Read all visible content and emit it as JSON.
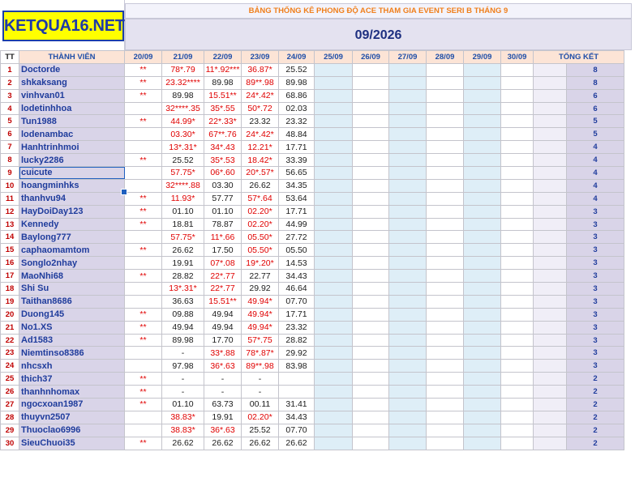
{
  "logo": "KETQUA16.NET",
  "title": "BẢNG THỐNG KÊ PHONG ĐỘ ACE THAM GIA EVENT SERI B THÁNG 9",
  "month": "09/2026",
  "headers": {
    "tt": "TT",
    "member": "THÀNH VIÊN",
    "dates": [
      "20/09",
      "21/09",
      "22/09",
      "23/09",
      "24/09",
      "25/09",
      "26/09",
      "27/09",
      "28/09",
      "29/09",
      "30/09"
    ],
    "total": "TỔNG KẾT"
  },
  "rows": [
    {
      "tt": "1",
      "name": "Doctorde",
      "c": [
        "**",
        "78*.79",
        "11*.92***",
        "36.87*",
        "25.52"
      ],
      "red": [
        true,
        true,
        true,
        true,
        false
      ],
      "total": "8"
    },
    {
      "tt": "2",
      "name": "shkaksang",
      "c": [
        "**",
        "23.32****",
        "89.98",
        "89**.98",
        "89.98"
      ],
      "red": [
        true,
        true,
        false,
        true,
        false
      ],
      "total": "8"
    },
    {
      "tt": "3",
      "name": "vinhvan01",
      "c": [
        "**",
        "89.98",
        "15.51**",
        "24*.42*",
        "68.86"
      ],
      "red": [
        true,
        false,
        true,
        true,
        false
      ],
      "total": "6"
    },
    {
      "tt": "4",
      "name": "lodetinhhoa",
      "c": [
        "",
        "32****.35",
        "35*.55",
        "50*.72",
        "02.03"
      ],
      "red": [
        false,
        true,
        true,
        true,
        false
      ],
      "total": "6"
    },
    {
      "tt": "5",
      "name": "Tun1988",
      "c": [
        "**",
        "44.99*",
        "22*.33*",
        "23.32",
        "23.32"
      ],
      "red": [
        true,
        true,
        true,
        false,
        false
      ],
      "total": "5"
    },
    {
      "tt": "6",
      "name": "lodenambac",
      "c": [
        "",
        "03.30*",
        "67**.76",
        "24*.42*",
        "48.84"
      ],
      "red": [
        false,
        true,
        true,
        true,
        false
      ],
      "total": "5"
    },
    {
      "tt": "7",
      "name": "Hanhtrinhmoi",
      "c": [
        "",
        "13*.31*",
        "34*.43",
        "12.21*",
        "17.71"
      ],
      "red": [
        false,
        true,
        true,
        true,
        false
      ],
      "total": "4"
    },
    {
      "tt": "8",
      "name": "lucky2286",
      "c": [
        "**",
        "25.52",
        "35*.53",
        "18.42*",
        "33.39"
      ],
      "red": [
        true,
        false,
        true,
        true,
        false
      ],
      "total": "4"
    },
    {
      "tt": "9",
      "name": "cuicute",
      "c": [
        "",
        "57.75*",
        "06*.60",
        "20*.57*",
        "56.65"
      ],
      "red": [
        false,
        true,
        true,
        true,
        false
      ],
      "total": "4"
    },
    {
      "tt": "10",
      "name": "hoangminhks",
      "c": [
        "",
        "32****.88",
        "03.30",
        "26.62",
        "34.35"
      ],
      "red": [
        false,
        true,
        false,
        false,
        false
      ],
      "total": "4"
    },
    {
      "tt": "11",
      "name": "thanhvu94",
      "c": [
        "**",
        "11.93*",
        "57.77",
        "57*.64",
        "53.64"
      ],
      "red": [
        true,
        true,
        false,
        true,
        false
      ],
      "total": "4"
    },
    {
      "tt": "12",
      "name": "HayDoiDay123",
      "c": [
        "**",
        "01.10",
        "01.10",
        "02.20*",
        "17.71"
      ],
      "red": [
        true,
        false,
        false,
        true,
        false
      ],
      "total": "3"
    },
    {
      "tt": "13",
      "name": "Kennedy",
      "c": [
        "**",
        "18.81",
        "78.87",
        "02.20*",
        "44.99"
      ],
      "red": [
        true,
        false,
        false,
        true,
        false
      ],
      "total": "3"
    },
    {
      "tt": "14",
      "name": "Baylong777",
      "c": [
        "",
        "57.75*",
        "11*.66",
        "05.50*",
        "27.72"
      ],
      "red": [
        false,
        true,
        true,
        true,
        false
      ],
      "total": "3"
    },
    {
      "tt": "15",
      "name": "caphaomamtom",
      "c": [
        "**",
        "26.62",
        "17.50",
        "05.50*",
        "05.50"
      ],
      "red": [
        true,
        false,
        false,
        true,
        false
      ],
      "total": "3"
    },
    {
      "tt": "16",
      "name": "Songlo2nhay",
      "c": [
        "",
        "19.91",
        "07*.08",
        "19*.20*",
        "14.53"
      ],
      "red": [
        false,
        false,
        true,
        true,
        false
      ],
      "total": "3"
    },
    {
      "tt": "17",
      "name": "MaoNhi68",
      "c": [
        "**",
        "28.82",
        "22*.77",
        "22.77",
        "34.43"
      ],
      "red": [
        true,
        false,
        true,
        false,
        false
      ],
      "total": "3"
    },
    {
      "tt": "18",
      "name": "Shi Su",
      "c": [
        "",
        "13*.31*",
        "22*.77",
        "29.92",
        "46.64"
      ],
      "red": [
        false,
        true,
        true,
        false,
        false
      ],
      "total": "3"
    },
    {
      "tt": "19",
      "name": "Taithan8686",
      "c": [
        "",
        "36.63",
        "15.51**",
        "49.94*",
        "07.70"
      ],
      "red": [
        false,
        false,
        true,
        true,
        false
      ],
      "total": "3"
    },
    {
      "tt": "20",
      "name": "Duong145",
      "c": [
        "**",
        "09.88",
        "49.94",
        "49.94*",
        "17.71"
      ],
      "red": [
        true,
        false,
        false,
        true,
        false
      ],
      "total": "3"
    },
    {
      "tt": "21",
      "name": "No1.XS",
      "c": [
        "**",
        "49.94",
        "49.94",
        "49.94*",
        "23.32"
      ],
      "red": [
        true,
        false,
        false,
        true,
        false
      ],
      "total": "3"
    },
    {
      "tt": "22",
      "name": "Ad1583",
      "c": [
        "**",
        "89.98",
        "17.70",
        "57*.75",
        "28.82"
      ],
      "red": [
        true,
        false,
        false,
        true,
        false
      ],
      "total": "3"
    },
    {
      "tt": "23",
      "name": "Niemtinso8386",
      "c": [
        "",
        "-",
        "33*.88",
        "78*.87*",
        "29.92"
      ],
      "red": [
        false,
        false,
        true,
        true,
        false
      ],
      "total": "3"
    },
    {
      "tt": "24",
      "name": "nhcsxh",
      "c": [
        "",
        "97.98",
        "36*.63",
        "89**.98",
        "83.98"
      ],
      "red": [
        false,
        false,
        true,
        true,
        false
      ],
      "total": "3"
    },
    {
      "tt": "25",
      "name": "thich37",
      "c": [
        "**",
        "-",
        "-",
        "-",
        ""
      ],
      "red": [
        true,
        false,
        false,
        false,
        false
      ],
      "total": "2"
    },
    {
      "tt": "26",
      "name": "thanhnhomax",
      "c": [
        "**",
        "-",
        "-",
        "-",
        ""
      ],
      "red": [
        true,
        false,
        false,
        false,
        false
      ],
      "total": "2"
    },
    {
      "tt": "27",
      "name": "ngocxoan1987",
      "c": [
        "**",
        "01.10",
        "63.73",
        "00.11",
        "31.41"
      ],
      "red": [
        true,
        false,
        false,
        false,
        false
      ],
      "total": "2"
    },
    {
      "tt": "28",
      "name": "thuyvn2507",
      "c": [
        "",
        "38.83*",
        "19.91",
        "02.20*",
        "34.43"
      ],
      "red": [
        false,
        true,
        false,
        true,
        false
      ],
      "total": "2"
    },
    {
      "tt": "29",
      "name": "Thuoclao6996",
      "c": [
        "",
        "38.83*",
        "36*.63",
        "25.52",
        "07.70"
      ],
      "red": [
        false,
        true,
        true,
        false,
        false
      ],
      "total": "2"
    },
    {
      "tt": "30",
      "name": "SieuChuoi35",
      "c": [
        "**",
        "26.62",
        "26.62",
        "26.62",
        "26.62"
      ],
      "red": [
        true,
        false,
        false,
        false,
        false
      ],
      "total": "2"
    }
  ]
}
